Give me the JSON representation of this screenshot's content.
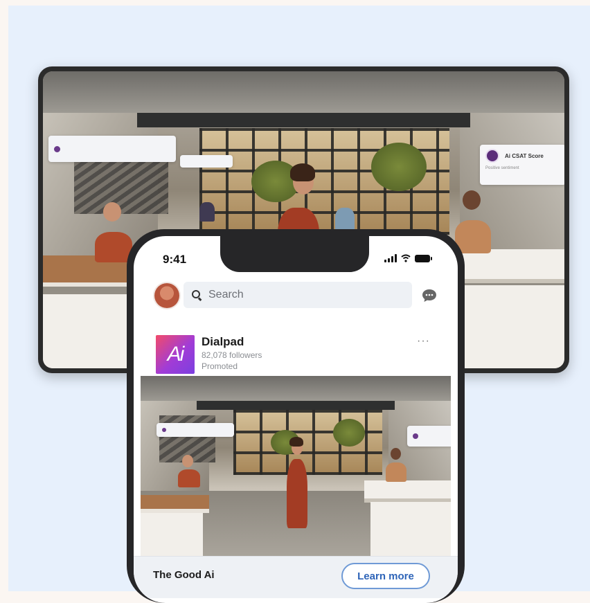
{
  "monitor": {
    "overlay_left_text": "",
    "overlay_mid_text": "",
    "csat_card": {
      "title": "Ai CSAT Score",
      "subtitle": "Positive sentiment"
    }
  },
  "phone": {
    "status_time": "9:41",
    "search_placeholder": "Search",
    "post": {
      "company": "Dialpad",
      "logo_text": "Ai",
      "followers": "82,078 followers",
      "promoted": "Promoted",
      "more_label": "···",
      "headline": "The Good Ai",
      "cta_label": "Learn more"
    }
  },
  "colors": {
    "page_background": "#e7f0fc",
    "brand_gradient_start": "#f24b6a",
    "brand_gradient_end": "#7b3fe0",
    "cta_text": "#2e64b8"
  }
}
